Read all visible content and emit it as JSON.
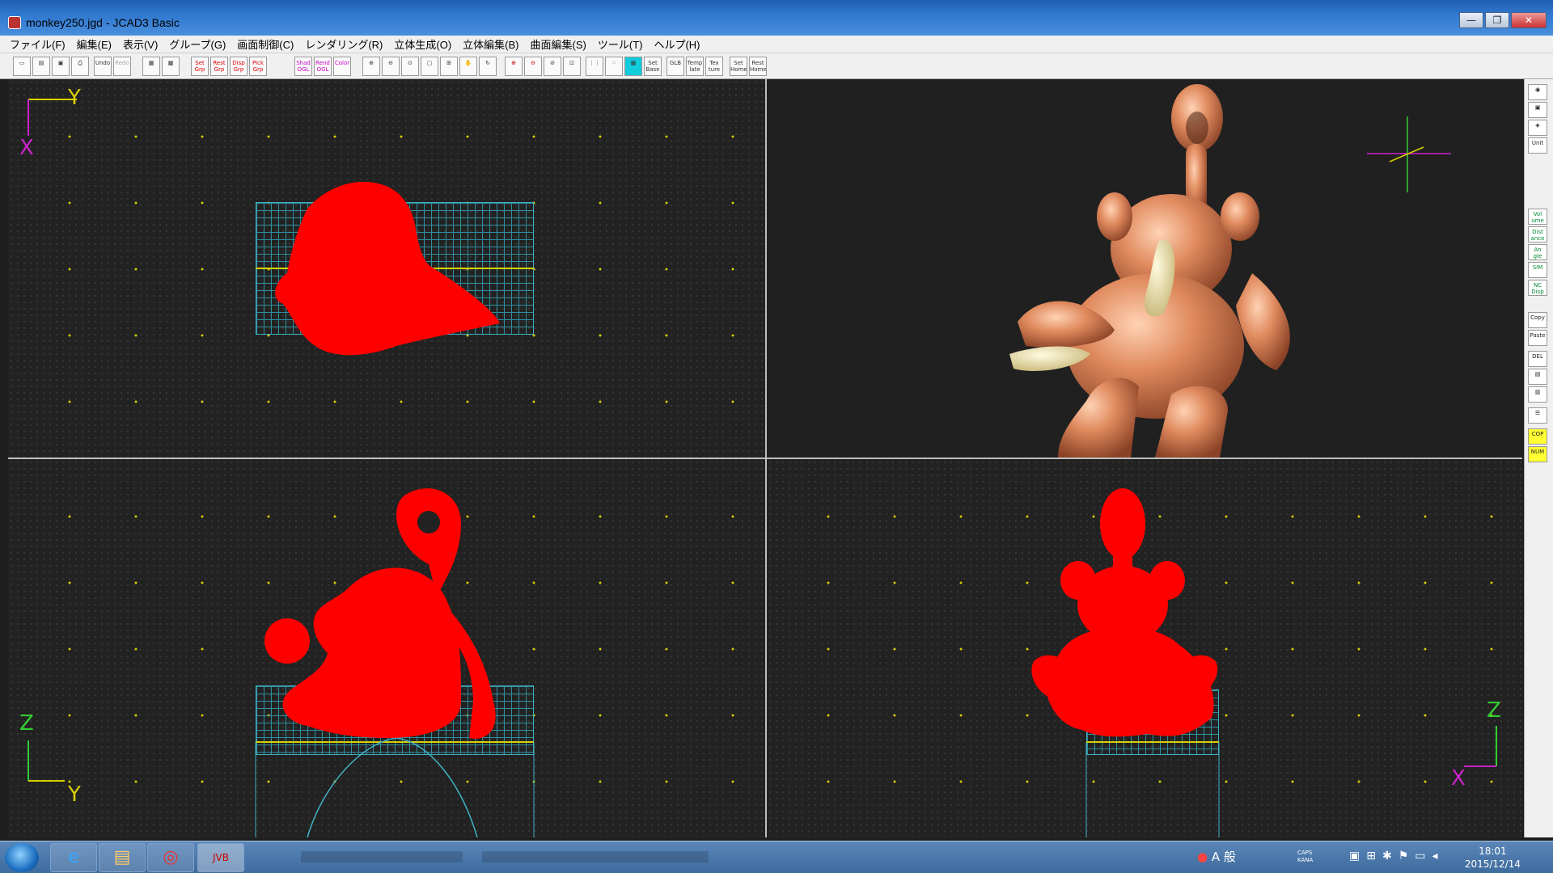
{
  "window": {
    "title": "monkey250.jgd - JCAD3 Basic",
    "controls": [
      "—",
      "❐",
      "✕"
    ]
  },
  "menu": [
    "ファイル(F)",
    "編集(E)",
    "表示(V)",
    "グループ(G)",
    "画面制御(C)",
    "レンダリング(R)",
    "立体生成(O)",
    "立体編集(B)",
    "曲面編集(S)",
    "ツール(T)",
    "ヘルプ(H)"
  ],
  "toolbar": {
    "undo": "Undo",
    "redo": "Redo",
    "set_grp": "Set Grp",
    "rest_grp": "Rest Grp",
    "disp_grp": "Disp Grp",
    "pick_grp": "Pick Grp",
    "shad_ogl": "Shad OGL",
    "rend_ogl": "Rend OGL",
    "color": "Color",
    "set_base": "Set Base",
    "glb": "GLB",
    "template": "Temp late",
    "texture": "Tex ture",
    "set_home": "Set Home",
    "rest_home": "Rest Home"
  },
  "viewports": {
    "top": {
      "axis_h": "Y",
      "axis_v": "X"
    },
    "front": {
      "axis_v": "Z",
      "axis_h": "Y"
    },
    "side": {
      "axis_v": "Z",
      "axis_h": "X"
    }
  },
  "side_tools": [
    "Unit",
    "Vol ume",
    "Dist ance",
    "An gle",
    "SIM",
    "NC Disp",
    "Copy",
    "Paste",
    "DEL",
    "COP",
    "NUM"
  ],
  "taskbar": {
    "tray_text": "A 般",
    "caps": "CAPS KANA",
    "time": "18:01",
    "date": "2015/12/14",
    "app_label": "JVB"
  },
  "colors": {
    "model_wire": "#ff0000",
    "grid_mesh": "#2f8fa0",
    "grid_dots": "#d8d000",
    "axis_yellow": "#d8d000",
    "axis_magenta": "#cc22cc",
    "axis_green": "#33cc33",
    "copper": "#e08a5e"
  }
}
